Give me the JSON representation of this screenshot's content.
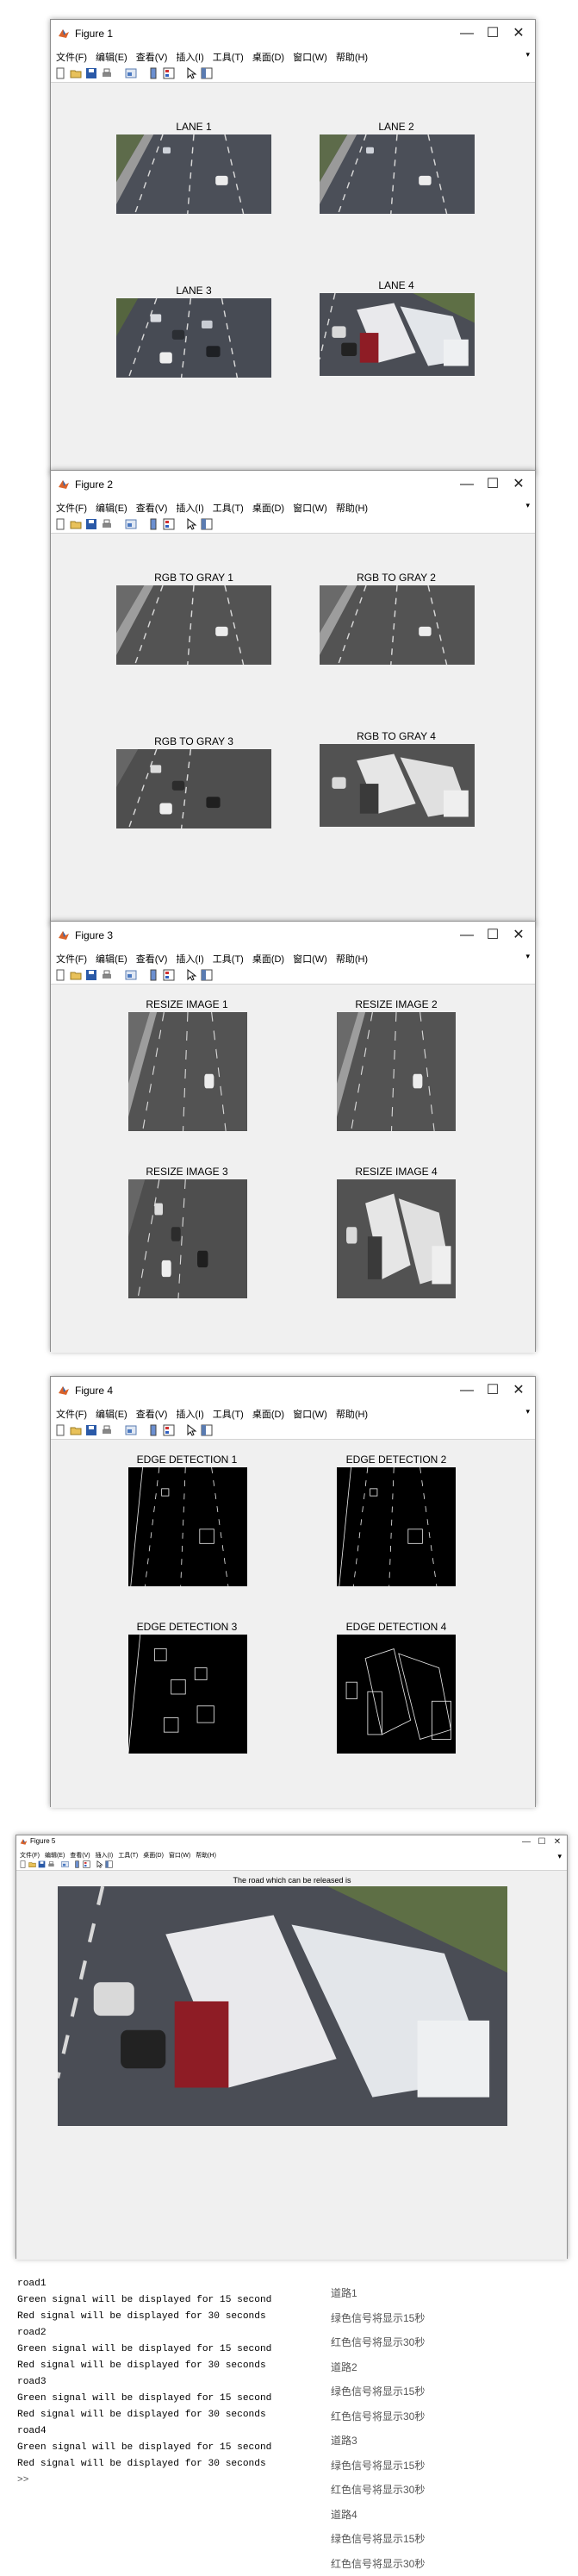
{
  "menu": [
    "文件(F)",
    "编辑(E)",
    "查看(V)",
    "插入(I)",
    "工具(T)",
    "桌面(D)",
    "窗口(W)",
    "帮助(H)"
  ],
  "window_controls": {
    "minimize": "—",
    "maximize": "☐",
    "close": "✕"
  },
  "figures": [
    {
      "title": "Figure 1",
      "labels": [
        "LANE 1",
        "LANE 2",
        "LANE 3",
        "LANE 4"
      ]
    },
    {
      "title": "Figure 2",
      "labels": [
        "RGB TO GRAY 1",
        "RGB TO GRAY 2",
        "RGB TO GRAY 3",
        "RGB TO GRAY 4"
      ]
    },
    {
      "title": "Figure 3",
      "labels": [
        "RESIZE IMAGE 1",
        "RESIZE IMAGE 2",
        "RESIZE IMAGE 3",
        "RESIZE IMAGE 4"
      ]
    },
    {
      "title": "Figure 4",
      "labels": [
        "EDGE DETECTION 1",
        "EDGE DETECTION 2",
        "EDGE DETECTION 3",
        "EDGE DETECTION 4"
      ]
    }
  ],
  "figure5": {
    "title": "Figure 5",
    "label": "The road which can be released is"
  },
  "console": [
    "road1",
    "Green signal will be displayed for 15 second",
    "Red signal will be displayed for 30 seconds",
    "road2",
    "Green signal will be displayed for 15 second",
    "Red signal will be displayed for 30 seconds",
    "road3",
    "Green signal will be displayed for 15 second",
    "Red signal will be displayed for 30 seconds",
    "road4",
    "Green signal will be displayed for 15 second",
    "Red signal will be displayed for 30 seconds"
  ],
  "prompt": ">>",
  "translations": [
    "道路1",
    "绿色信号将显示15秒",
    "红色信号将显示30秒",
    "道路2",
    "绿色信号将显示15秒",
    "红色信号将显示30秒",
    "道路3",
    "绿色信号将显示15秒",
    "红色信号将显示30秒",
    "道路4",
    "绿色信号将显示15秒",
    "红色信号将显示30秒"
  ]
}
